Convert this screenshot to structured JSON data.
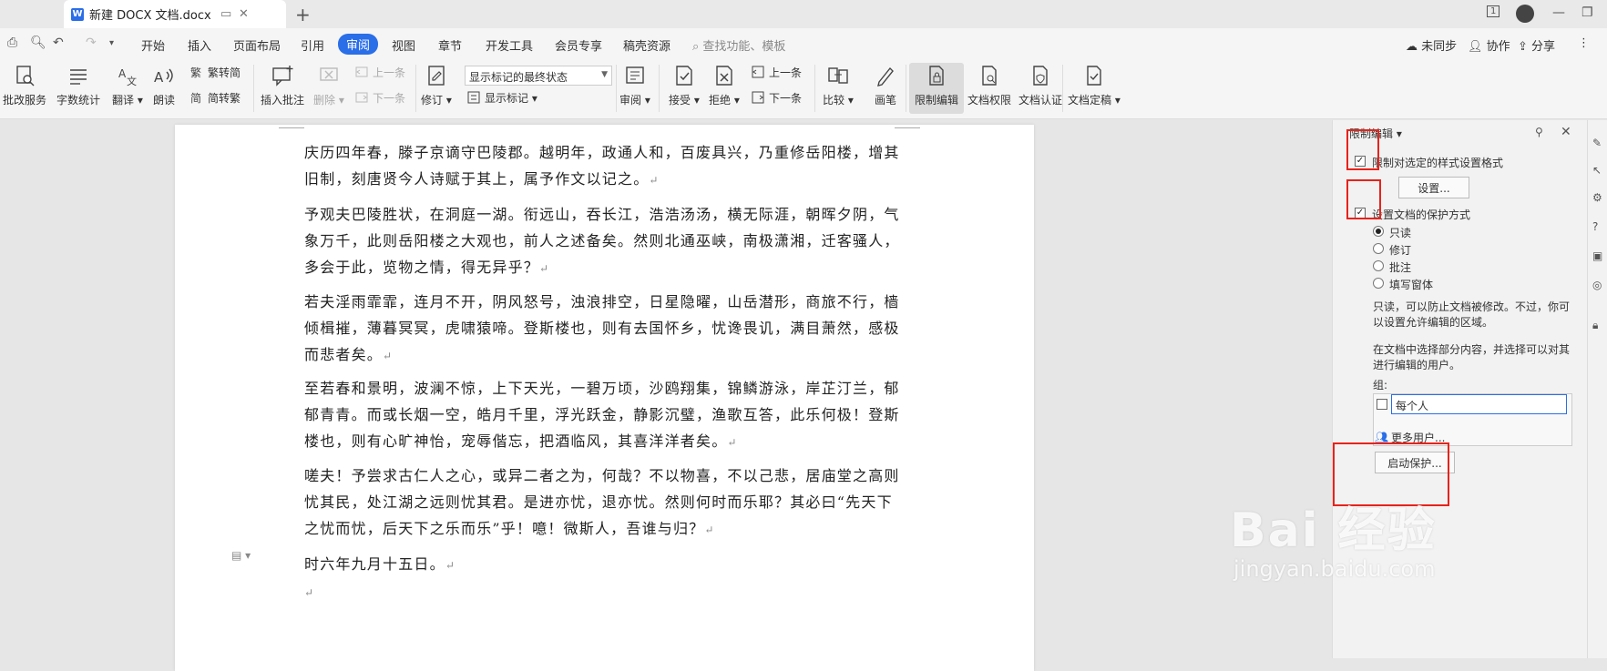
{
  "titlebar": {
    "doc_tab_title": "新建 DOCX 文档.docx",
    "app_badge": "W",
    "page_indicator": "1"
  },
  "menubar": {
    "items": [
      "开始",
      "插入",
      "页面布局",
      "引用",
      "审阅",
      "视图",
      "章节",
      "开发工具",
      "会员专享",
      "稿壳资源"
    ],
    "active": "审阅",
    "search_placeholder": "查找功能、模板",
    "right": {
      "sync": "未同步",
      "collab": "协作",
      "share": "分享"
    }
  },
  "ribbon": {
    "pigai": "批改服务",
    "word_count": "字数统计",
    "translate": "翻译",
    "read_aloud": "朗读",
    "trad_to_simp": "繁转简",
    "simp_to_trad": "简转繁",
    "insert_comment": "插入批注",
    "delete": "删除",
    "prev": "上一条",
    "next": "下一条",
    "revise": "修订",
    "markup_state": "显示标记的最终状态",
    "show_markup": "显示标记",
    "review": "审阅",
    "accept": "接受",
    "reject": "拒绝",
    "prev2": "上一条",
    "next2": "下一条",
    "compare": "比较",
    "pen": "画笔",
    "restrict_edit": "限制编辑",
    "doc_rights": "文档权限",
    "doc_cert": "文档认证",
    "doc_final": "文档定稿"
  },
  "document": {
    "paragraphs": [
      "庆历四年春，滕子京谪守巴陵郡。越明年，政通人和，百废具兴，乃重修岳阳楼，增其旧制，刻唐贤今人诗赋于其上，属予作文以记之。",
      "予观夫巴陵胜状，在洞庭一湖。衔远山，吞长江，浩浩汤汤，横无际涯，朝晖夕阴，气象万千，此则岳阳楼之大观也，前人之述备矣。然则北通巫峡，南极潇湘，迁客骚人，多会于此，览物之情，得无异乎？",
      "若夫淫雨霏霏，连月不开，阴风怒号，浊浪排空，日星隐曜，山岳潜形，商旅不行，樯倾楫摧，薄暮冥冥，虎啸猿啼。登斯楼也，则有去国怀乡，忧谗畏讥，满目萧然，感极而悲者矣。",
      "至若春和景明，波澜不惊，上下天光，一碧万顷，沙鸥翔集，锦鳞游泳，岸芷汀兰，郁郁青青。而或长烟一空，皓月千里，浮光跃金，静影沉璧，渔歌互答，此乐何极！登斯楼也，则有心旷神怡，宠辱偕忘，把酒临风，其喜洋洋者矣。",
      "嗟夫！予尝求古仁人之心，或异二者之为，何哉？不以物喜，不以己悲，居庙堂之高则忧其民，处江湖之远则忧其君。是进亦忧，退亦忧。然则何时而乐耶？其必曰“先天下之忧而忧，后天下之乐而乐”乎！噫！微斯人，吾谁与归？",
      "时六年九月十五日。"
    ],
    "para_mark": "↵"
  },
  "panel": {
    "title": "限制编辑",
    "restrict_format": "限制对选定的样式设置格式",
    "settings_btn": "设置...",
    "protect_mode": "设置文档的保护方式",
    "options": [
      "只读",
      "修订",
      "批注",
      "填写窗体"
    ],
    "selected_option": "只读",
    "desc1_line1": "只读，可以防止文档被修改。不过，你可",
    "desc1_line2": "以设置允许编辑的区域。",
    "desc2_line1": "在文档中选择部分内容，并选择可以对其",
    "desc2_line2": "进行编辑的用户。",
    "group_label": "组:",
    "group_everyone": "每个人",
    "more_users": "更多用户...",
    "start_protect": "启动保护..."
  },
  "watermark": {
    "brand": "Bai 经验",
    "url": "jingyan.baidu.com"
  },
  "colors": {
    "accent": "#2a6ee8",
    "highlight": "#e8221a"
  }
}
